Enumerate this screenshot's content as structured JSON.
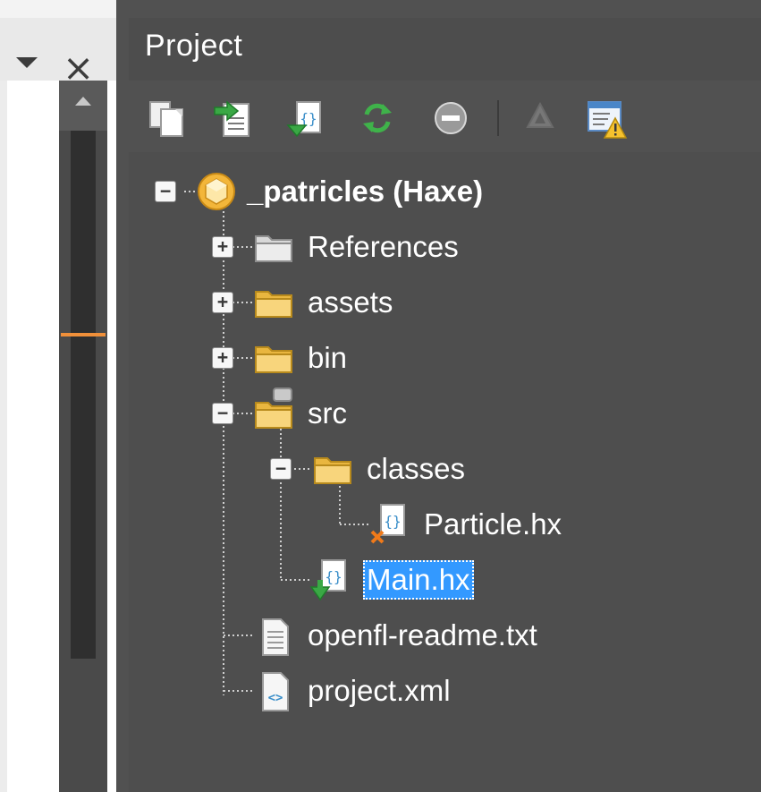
{
  "left_panel": {
    "dropdown_icon": "chevron-down-icon",
    "close_label": "×"
  },
  "project_panel": {
    "title": "Project",
    "toolbar": [
      {
        "name": "copy-icon"
      },
      {
        "name": "insert-into-document-icon"
      },
      {
        "name": "add-class-icon"
      },
      {
        "name": "refresh-icon"
      },
      {
        "name": "collapse-all-icon"
      },
      {
        "name": "haxe-build-icon"
      },
      {
        "name": "project-properties-warning-icon"
      }
    ],
    "tree": {
      "root": {
        "label": "_patricles (Haxe)",
        "expanded": true,
        "icon": "haxe-project-icon"
      },
      "nodes": [
        {
          "label": "References",
          "icon": "folder-gray-icon",
          "expanded": false
        },
        {
          "label": "assets",
          "icon": "folder-icon",
          "expanded": false
        },
        {
          "label": "bin",
          "icon": "folder-icon",
          "expanded": false
        },
        {
          "label": "src",
          "icon": "classpath-folder-icon",
          "expanded": true
        },
        {
          "label": "classes",
          "icon": "folder-icon",
          "expanded": true
        },
        {
          "label": "Particle.hx",
          "icon": "haxe-class-excluded-icon"
        },
        {
          "label": "Main.hx",
          "icon": "haxe-class-document-class-icon",
          "selected": true
        },
        {
          "label": "openfl-readme.txt",
          "icon": "text-file-icon"
        },
        {
          "label": "project.xml",
          "icon": "xml-file-icon"
        }
      ]
    }
  },
  "colors": {
    "panel_bg": "#4e4e4e",
    "selection": "#3399ff",
    "folder": "#f5c75a",
    "scroll_marker": "#f0903a"
  }
}
